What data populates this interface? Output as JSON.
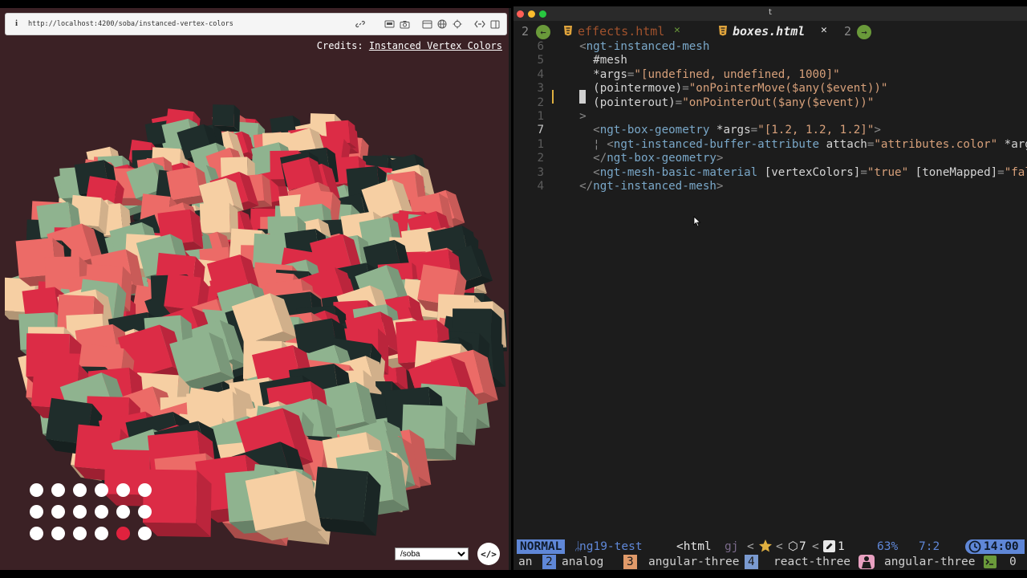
{
  "browser": {
    "info_glyph": "i",
    "url": "http://localhost:4200/soba/instanced-vertex-colors",
    "icons": [
      "link-icon",
      "screen-capture-icon",
      "camera-icon",
      "panel-icon",
      "globe-icon",
      "crosshair-icon",
      "code-compare-icon",
      "sidebar-icon"
    ],
    "credits_label": "Credits:",
    "credits_link": "Instanced Vertex Colors",
    "palette": [
      "#f6cfa3",
      "#ec6b67",
      "#dc2c46",
      "#8fb38f",
      "#1f2d2b"
    ],
    "dots_active_index": 16,
    "route_value": "/soba",
    "code_button": "</>"
  },
  "editor": {
    "window_title": "t",
    "tabs": {
      "left_count": "2",
      "tab1": "effects.html",
      "tab1_close": "✕",
      "tab2": "boxes.html",
      "tab2_close": "✕",
      "right_count": "2"
    },
    "lines": [
      {
        "num": "6",
        "parts": [
          {
            "c": "pun",
            "t": "  <"
          },
          {
            "c": "tag",
            "t": "ngt-instanced-mesh"
          }
        ]
      },
      {
        "num": "5",
        "parts": [
          {
            "c": "attr",
            "t": "    #mesh"
          }
        ]
      },
      {
        "num": "4",
        "parts": [
          {
            "c": "attr",
            "t": "    *args"
          },
          {
            "c": "pun",
            "t": "="
          },
          {
            "c": "str",
            "t": "\"[undefined, undefined, 1000]\""
          }
        ]
      },
      {
        "num": "3",
        "parts": [
          {
            "c": "attr",
            "t": "    (pointermove)"
          },
          {
            "c": "pun",
            "t": "="
          },
          {
            "c": "str",
            "t": "\"onPointerMove($any($event))\""
          }
        ]
      },
      {
        "num": "2",
        "parts": [
          {
            "c": "attr",
            "t": "    (pointerout)"
          },
          {
            "c": "pun",
            "t": "="
          },
          {
            "c": "str",
            "t": "\"onPointerOut($any($event))\""
          }
        ]
      },
      {
        "num": "1",
        "parts": [
          {
            "c": "pun",
            "t": "  >"
          }
        ]
      },
      {
        "num": "7",
        "parts": [
          {
            "c": "pun",
            "t": "    <"
          },
          {
            "c": "tag",
            "t": "ngt-box-geometry"
          },
          {
            "c": "attr",
            "t": " *args"
          },
          {
            "c": "pun",
            "t": "="
          },
          {
            "c": "str",
            "t": "\"[1.2, 1.2, 1.2]\""
          },
          {
            "c": "pun",
            "t": ">"
          }
        ]
      },
      {
        "num": "1",
        "parts": [
          {
            "c": "pun",
            "t": "    ¦ <"
          },
          {
            "c": "tag",
            "t": "ngt-instanced-buffer-attribute"
          },
          {
            "c": "attr",
            "t": " attach"
          },
          {
            "c": "pun",
            "t": "="
          },
          {
            "c": "str",
            "t": "\"attributes.color\""
          },
          {
            "c": "attr",
            "t": " *arg"
          }
        ]
      },
      {
        "num": "2",
        "parts": [
          {
            "c": "pun",
            "t": "    </"
          },
          {
            "c": "tag",
            "t": "ngt-box-geometry"
          },
          {
            "c": "pun",
            "t": ">"
          }
        ]
      },
      {
        "num": "3",
        "parts": [
          {
            "c": "pun",
            "t": "    <"
          },
          {
            "c": "tag",
            "t": "ngt-mesh-basic-material"
          },
          {
            "c": "attr",
            "t": " [vertexColors]"
          },
          {
            "c": "pun",
            "t": "="
          },
          {
            "c": "str",
            "t": "\"true\""
          },
          {
            "c": "attr",
            "t": " [toneMapped]"
          },
          {
            "c": "pun",
            "t": "="
          },
          {
            "c": "str",
            "t": "\"fal"
          }
        ]
      },
      {
        "num": "4",
        "parts": [
          {
            "c": "pun",
            "t": "  </"
          },
          {
            "c": "tag",
            "t": "ngt-instanced-mesh"
          },
          {
            "c": "pun",
            "t": ">"
          }
        ]
      }
    ],
    "current_line_index": 6,
    "status": {
      "mode": "NORMAL",
      "branch": " ng19-test",
      "filetype": "<html",
      "keys": "gj",
      "star_count": "",
      "box_count": "7",
      "edit_count": "1",
      "percent": "63%",
      "position": "7:2",
      "time": "14:00"
    },
    "tmux": {
      "w0": "an",
      "w1_num": "2",
      "w1": "analog",
      "w2_num": "3",
      "w2": "angular-three",
      "w3_num": "4",
      "w3": "react-three",
      "w4": "angular-three",
      "w5": "0"
    }
  }
}
